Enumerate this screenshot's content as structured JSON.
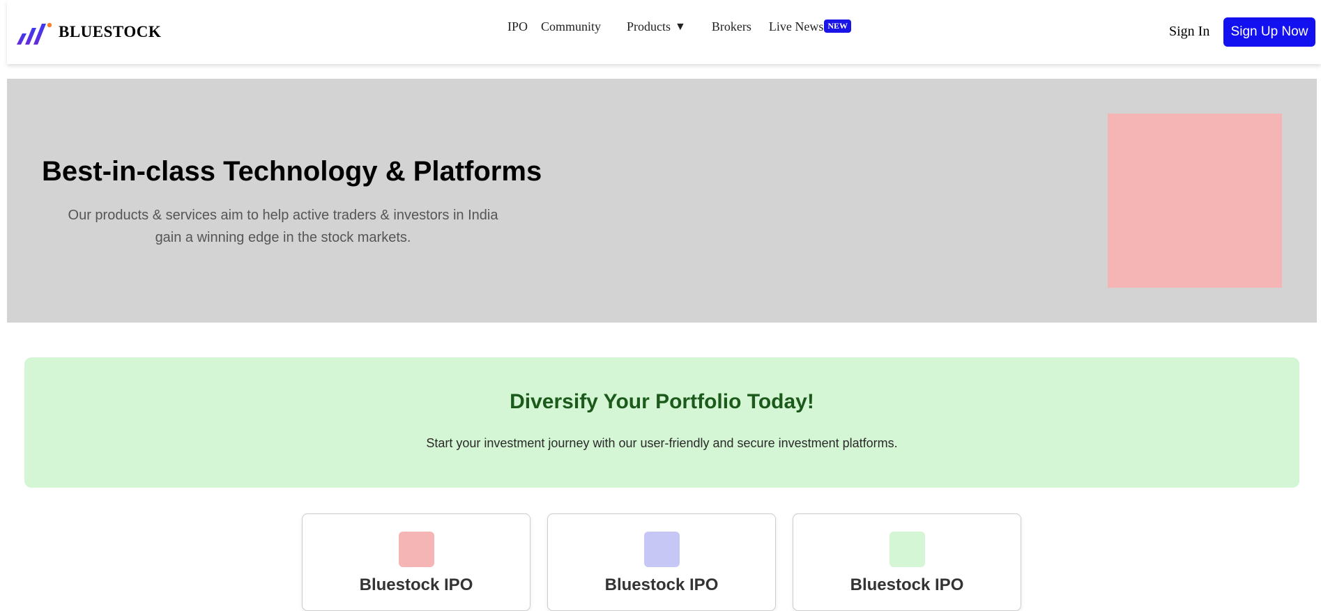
{
  "header": {
    "brand": "BLUESTOCK",
    "nav": {
      "ipo": "IPO",
      "community": "Community",
      "products": "Products",
      "products_caret": "▼",
      "brokers": "Brokers",
      "live_news": "Live News",
      "new_badge": "NEW"
    },
    "sign_in": "Sign In",
    "sign_up": "Sign Up Now"
  },
  "hero": {
    "title": "Best-in-class Technology & Platforms",
    "subtitle": "Our products & services aim to help active traders & investors in India gain a winning edge in the stock markets."
  },
  "promo": {
    "title": "Diversify Your Portfolio Today!",
    "text": "Start your investment journey with our user-friendly and secure investment platforms."
  },
  "cards": [
    {
      "title": "Bluestock IPO",
      "icon_color": "#f6b5b5"
    },
    {
      "title": "Bluestock IPO",
      "icon_color": "#c7c7f6"
    },
    {
      "title": "Bluestock IPO",
      "icon_color": "#d4f6d4"
    }
  ],
  "colors": {
    "accent": "#1411f0",
    "hero_bg": "#d3d3d3",
    "hero_image": "#f6b5b5",
    "promo_bg": "#d4f6d4",
    "promo_title": "#1b5a1b"
  }
}
